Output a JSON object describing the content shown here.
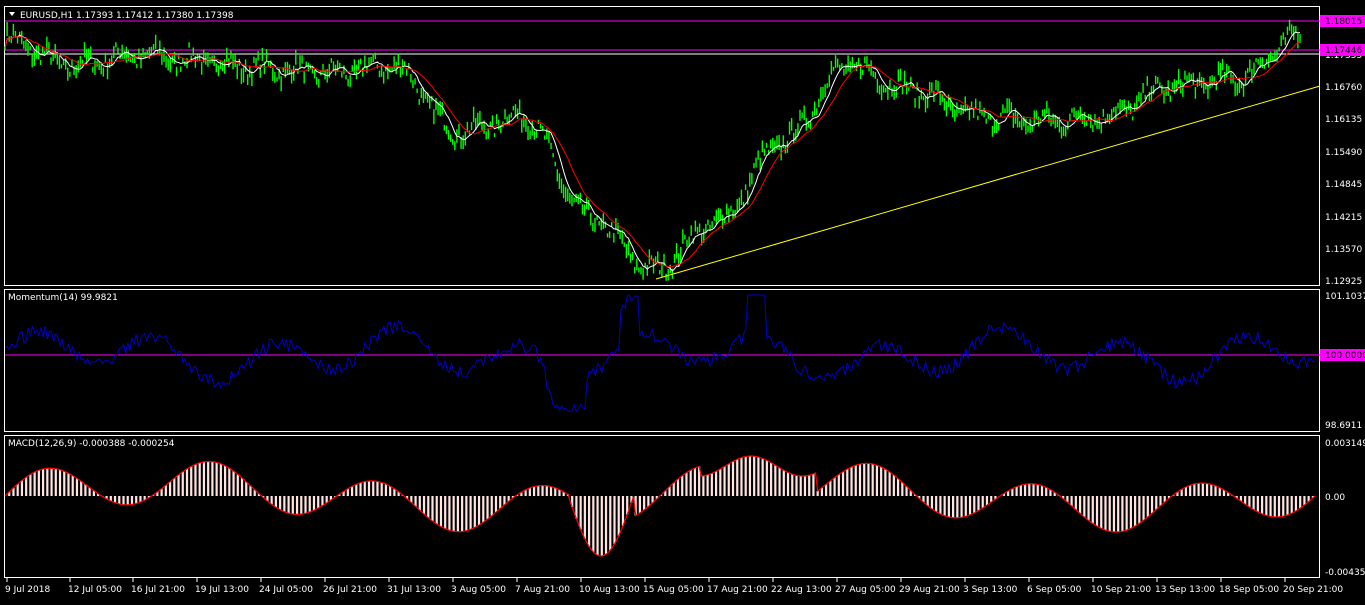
{
  "colors": {
    "background": "#000000",
    "frame": "#ffffff",
    "price_bars": "#00ff00",
    "ma_fast": "#ffffff",
    "ma_slow": "#ff0000",
    "trendline": "#ffff00",
    "level_line": "#ff00ff",
    "momentum_line": "#0000cc",
    "macd_hist": "#ffe4e1",
    "macd_signal": "#ff0000"
  },
  "main_chart": {
    "header": "EURUSD,H1  1.17393 1.17412 1.17380 1.17398",
    "price_labels": [
      "1.17355",
      "1.16760",
      "1.16135",
      "1.15490",
      "1.14845",
      "1.14215",
      "1.13570",
      "1.12925"
    ],
    "level_badges": [
      "1.18015",
      "1.17446"
    ],
    "levels": [
      1.18015,
      1.17446,
      1.174
    ],
    "y_range": [
      1.12925,
      1.181
    ],
    "trendline": {
      "from": [
        15.9,
        1.12925
      ],
      "to": [
        22.8,
        1.167
      ]
    }
  },
  "momentum": {
    "label": "Momentum(14) 99.9821",
    "axis_labels": [
      "101.1037",
      "100.0000",
      "98.6911"
    ],
    "y_range": [
      98.6911,
      101.1037
    ],
    "reference": 100.0
  },
  "macd": {
    "label": "MACD(12,26,9) -0.000388 -0.000254",
    "axis_labels": [
      "0.003149",
      "0.00",
      "-0.004353"
    ],
    "y_range": [
      -0.004353,
      0.003149
    ]
  },
  "time_axis": [
    "9 Jul 2018",
    "12 Jul 05:00",
    "16 Jul 21:00",
    "19 Jul 13:00",
    "24 Jul 05:00",
    "26 Jul 21:00",
    "31 Jul 13:00",
    "3 Aug 05:00",
    "7 Aug 21:00",
    "10 Aug 13:00",
    "15 Aug 05:00",
    "17 Aug 21:00",
    "22 Aug 13:00",
    "27 Aug 05:00",
    "29 Aug 21:00",
    "3 Sep 13:00",
    "6 Sep 05:00",
    "10 Sep 21:00",
    "13 Sep 13:00",
    "18 Sep 05:00",
    "20 Sep 21:00"
  ],
  "chart_data": {
    "type": "line",
    "title": "EURUSD,H1",
    "x": [
      "9 Jul 2018",
      "12 Jul 05:00",
      "16 Jul 21:00",
      "19 Jul 13:00",
      "24 Jul 05:00",
      "26 Jul 21:00",
      "31 Jul 13:00",
      "3 Aug 05:00",
      "7 Aug 21:00",
      "10 Aug 13:00",
      "15 Aug 05:00",
      "17 Aug 21:00",
      "22 Aug 13:00",
      "27 Aug 05:00",
      "29 Aug 21:00",
      "3 Sep 13:00",
      "6 Sep 05:00",
      "10 Sep 21:00",
      "13 Sep 13:00",
      "18 Sep 05:00",
      "20 Sep 21:00"
    ],
    "series": [
      {
        "values": [
          1.1755,
          1.1705,
          1.1725,
          1.1715,
          1.17,
          1.169,
          1.1705,
          1.158,
          1.161,
          1.142,
          1.132,
          1.141,
          1.156,
          1.1705,
          1.166,
          1.161,
          1.16,
          1.161,
          1.1665,
          1.168,
          1.176
        ]
      }
    ],
    "ylim": [
      1.12925,
      1.181
    ]
  }
}
